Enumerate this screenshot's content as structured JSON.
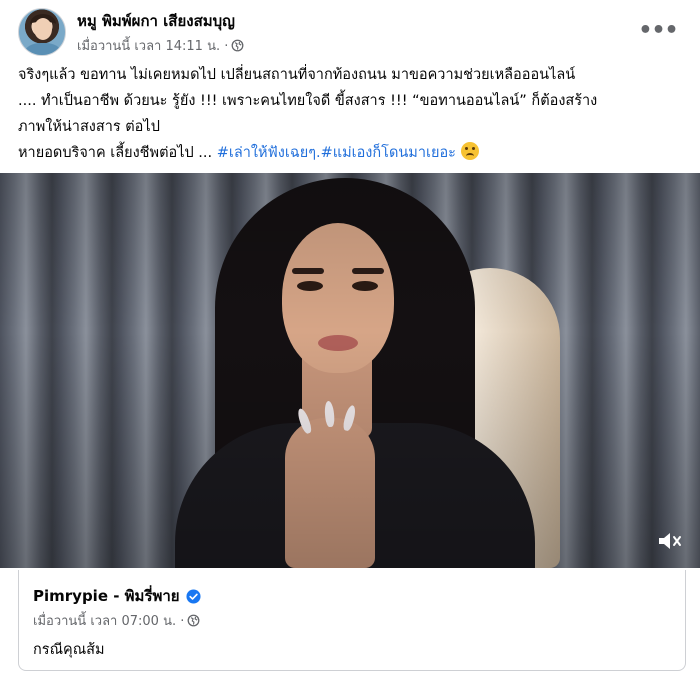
{
  "post": {
    "author": "หมู พิมพ์ผกา เสียงสมบุญ",
    "timestamp": "เมื่อวานนี้ เวลา 14:11 น. ·",
    "privacy_icon": "globe-icon",
    "more_icon": "more-options-icon",
    "more_label": "•••",
    "text_lines": [
      "จริงๆแล้ว ขอทาน ไม่เคยหมดไป เปลี่ยนสถานที่จากท้องถนน มาขอความช่วยเหลือออนไลน์",
      ".... ทำเป็นอาชีพ ด้วยนะ รู้ยัง !!! เพราะคนไทยใจดี ขี้สงสาร !!!  “ขอทานออนไลน์” ก็ต้องสร้าง",
      "ภาพให้น่าสงสาร  ต่อไป"
    ],
    "last_line_text": "หายอดบริจาค เลี้ยงชีพต่อไป ...",
    "hashtag_1": "#เล่าให้ฟังเฉยๆ.",
    "hashtag_2": "#แม่เองก็โดนมาเยอะ",
    "emoji": "worried-face-emoji"
  },
  "video": {
    "mute_icon": "speaker-muted-icon"
  },
  "shared_post": {
    "author": "Pimrypie - พิมรี่พาย",
    "verified_icon": "verified-badge-icon",
    "timestamp": "เมื่อวานนี้ เวลา 07:00 น. ·",
    "privacy_icon": "globe-icon",
    "text": "กรณีคุณส้ม"
  },
  "colors": {
    "text": "#050505",
    "secondary_text": "#65676b",
    "hashtag": "#216fdb",
    "verified": "#1877f2",
    "border": "#ced0d4"
  }
}
